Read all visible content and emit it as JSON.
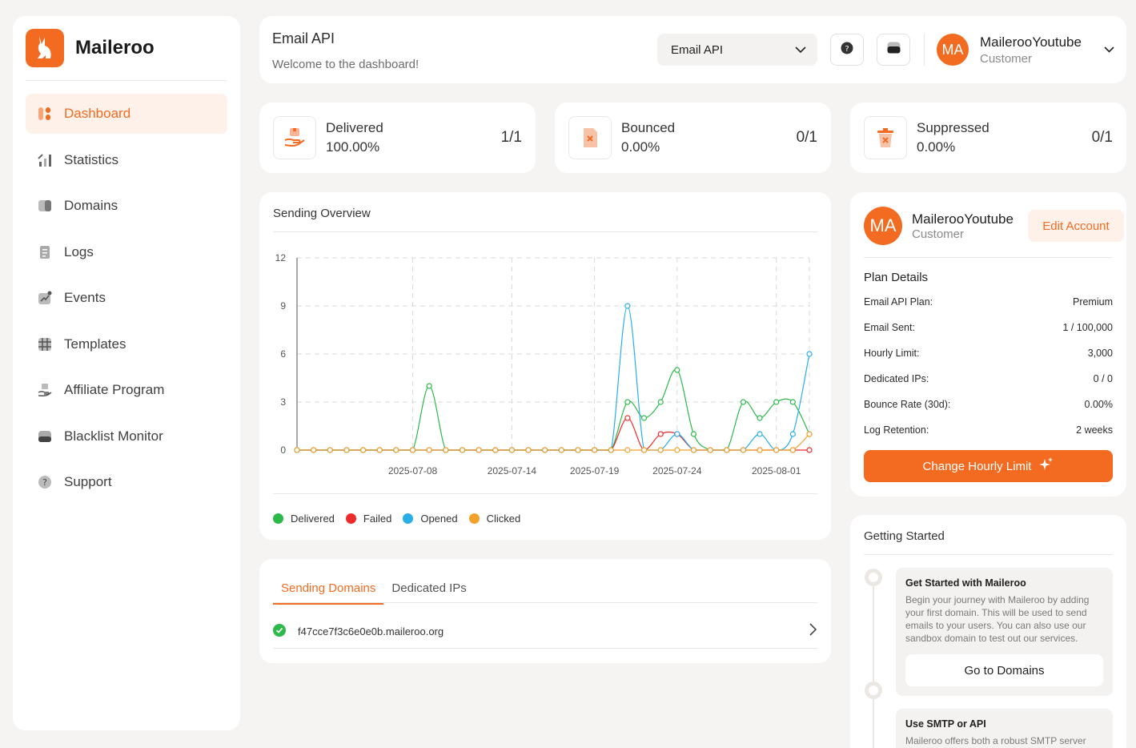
{
  "brand": {
    "name": "Maileroo"
  },
  "colors": {
    "accent": "#f26b21",
    "delivered": "#2bb94a",
    "failed": "#ee2b2b",
    "opened": "#29aee8",
    "clicked": "#f2a12a"
  },
  "sidebar": {
    "items": [
      {
        "label": "Dashboard",
        "icon": "dashboard-icon",
        "active": true
      },
      {
        "label": "Statistics",
        "icon": "statistics-icon"
      },
      {
        "label": "Domains",
        "icon": "domains-icon"
      },
      {
        "label": "Logs",
        "icon": "logs-icon"
      },
      {
        "label": "Events",
        "icon": "events-icon"
      },
      {
        "label": "Templates",
        "icon": "templates-icon"
      },
      {
        "label": "Affiliate Program",
        "icon": "affiliate-icon"
      },
      {
        "label": "Blacklist Monitor",
        "icon": "blacklist-icon"
      },
      {
        "label": "Support",
        "icon": "support-icon"
      }
    ]
  },
  "header": {
    "title": "Email API",
    "subtitle": "Welcome to the dashboard!",
    "product_select": "Email API",
    "user": {
      "initials": "MA",
      "name": "MailerooYoutube",
      "role": "Customer"
    }
  },
  "stats": [
    {
      "label": "Delivered",
      "value": "100.00%",
      "count": "1/1",
      "icon": "delivered-icon"
    },
    {
      "label": "Bounced",
      "value": "0.00%",
      "count": "0/1",
      "icon": "bounced-icon"
    },
    {
      "label": "Suppressed",
      "value": "0.00%",
      "count": "0/1",
      "icon": "suppressed-icon"
    }
  ],
  "overview": {
    "title": "Sending Overview",
    "legend": [
      "Delivered",
      "Failed",
      "Opened",
      "Clicked"
    ]
  },
  "chart_data": {
    "type": "line",
    "x_count": 32,
    "x_ticks": [
      {
        "index": 7,
        "label": "2025-07-08"
      },
      {
        "index": 13,
        "label": "2025-07-14"
      },
      {
        "index": 18,
        "label": "2025-07-19"
      },
      {
        "index": 23,
        "label": "2025-07-24"
      },
      {
        "index": 29,
        "label": "2025-08-01"
      }
    ],
    "ylim": [
      0,
      12
    ],
    "y_ticks": [
      0,
      3,
      6,
      9,
      12
    ],
    "grid": true,
    "legend_placement": "bottom-left",
    "series": [
      {
        "name": "Delivered",
        "values": [
          0,
          0,
          0,
          0,
          0,
          0,
          0,
          0,
          4,
          0,
          0,
          0,
          0,
          0,
          0,
          0,
          0,
          0,
          0,
          0,
          3,
          2,
          3,
          5,
          1,
          0,
          0,
          3,
          2,
          3,
          3,
          1
        ]
      },
      {
        "name": "Failed",
        "values": [
          0,
          0,
          0,
          0,
          0,
          0,
          0,
          0,
          0,
          0,
          0,
          0,
          0,
          0,
          0,
          0,
          0,
          0,
          0,
          0,
          2,
          0,
          1,
          1,
          0,
          0,
          0,
          0,
          0,
          0,
          0,
          0
        ]
      },
      {
        "name": "Opened",
        "values": [
          0,
          0,
          0,
          0,
          0,
          0,
          0,
          0,
          0,
          0,
          0,
          0,
          0,
          0,
          0,
          0,
          0,
          0,
          0,
          0,
          9,
          0,
          0,
          1,
          0,
          0,
          0,
          0,
          1,
          0,
          1,
          6
        ]
      },
      {
        "name": "Clicked",
        "values": [
          0,
          0,
          0,
          0,
          0,
          0,
          0,
          0,
          0,
          0,
          0,
          0,
          0,
          0,
          0,
          0,
          0,
          0,
          0,
          0,
          0,
          0,
          0,
          0,
          0,
          0,
          0,
          0,
          0,
          0,
          0,
          1
        ]
      }
    ]
  },
  "domains": {
    "tabs": [
      "Sending Domains",
      "Dedicated IPs"
    ],
    "items": [
      {
        "name": "f47cce7f3c6e0e0b.maileroo.org",
        "status": "verified"
      }
    ]
  },
  "account": {
    "initials": "MA",
    "name": "MailerooYoutube",
    "role": "Customer",
    "edit_label": "Edit Account",
    "plan_title": "Plan Details",
    "plan": [
      {
        "label": "Email API Plan:",
        "value": "Premium"
      },
      {
        "label": "Email Sent:",
        "value": "1 / 100,000"
      },
      {
        "label": "Hourly Limit:",
        "value": "3,000"
      },
      {
        "label": "Dedicated IPs:",
        "value": "0 / 0"
      },
      {
        "label": "Bounce Rate (30d):",
        "value": "0.00%"
      },
      {
        "label": "Log Retention:",
        "value": "2 weeks"
      }
    ],
    "cta_label": "Change Hourly Limit"
  },
  "getting_started": {
    "title": "Getting Started",
    "steps": [
      {
        "title": "Get Started with Maileroo",
        "body": "Begin your journey with Maileroo by adding your first domain. This will be used to send emails to your users. You can also use our sandbox domain to test out our services.",
        "button": "Go to Domains"
      },
      {
        "title": "Use SMTP or API",
        "body": "Maileroo offers both a robust SMTP server"
      }
    ]
  }
}
